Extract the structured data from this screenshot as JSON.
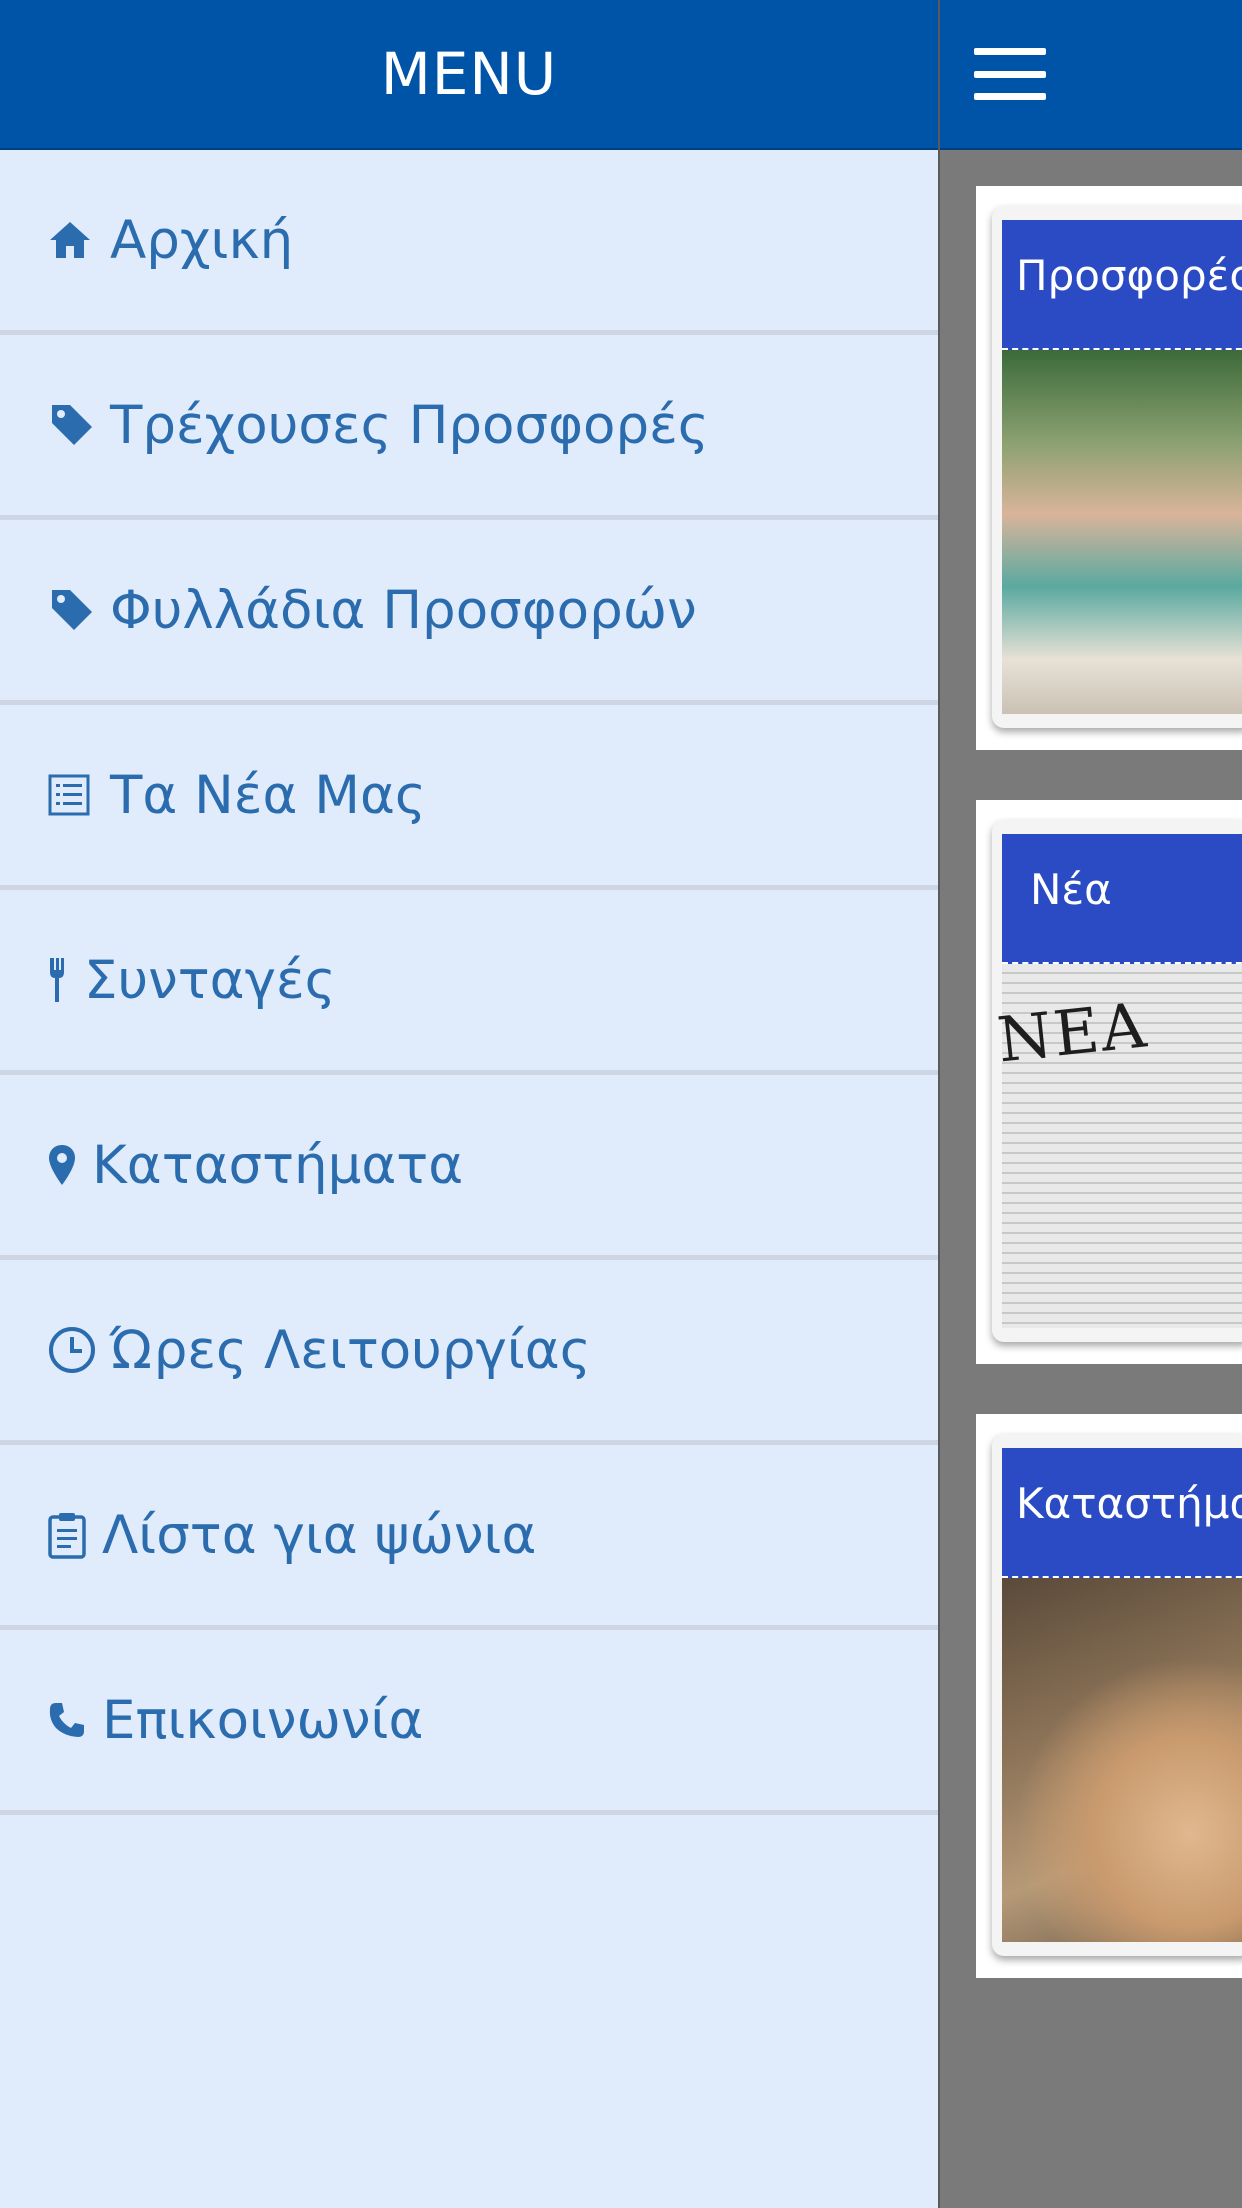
{
  "menu": {
    "title": "MENU",
    "items": [
      {
        "label": "Αρχική",
        "icon": "home-icon"
      },
      {
        "label": "Τρέχουσες Προσφορές",
        "icon": "tag-icon"
      },
      {
        "label": "Φυλλάδια Προσφορών",
        "icon": "tag-icon"
      },
      {
        "label": "Τα Νέα Μας",
        "icon": "list-icon"
      },
      {
        "label": "Συνταγές",
        "icon": "utensils-icon"
      },
      {
        "label": "Καταστήματα",
        "icon": "map-marker-icon"
      },
      {
        "label": "Ώρες Λειτουργίας",
        "icon": "clock-icon"
      },
      {
        "label": "Λίστα για ψώνια",
        "icon": "clipboard-icon"
      },
      {
        "label": "Επικοινωνία",
        "icon": "phone-icon"
      }
    ]
  },
  "topbar": {
    "menu_toggle_icon": "hamburger-menu-icon"
  },
  "cards": [
    {
      "title": "Προσφορές"
    },
    {
      "title": "Νέα",
      "image_text": "NEA"
    },
    {
      "title": "Καταστήματα"
    }
  ],
  "colors": {
    "header_blue": "#0054a8",
    "menu_background": "#e0ebfc",
    "menu_text": "#2a6cad",
    "card_banner": "#2a4bc4",
    "page_background": "#7a7a7a"
  }
}
